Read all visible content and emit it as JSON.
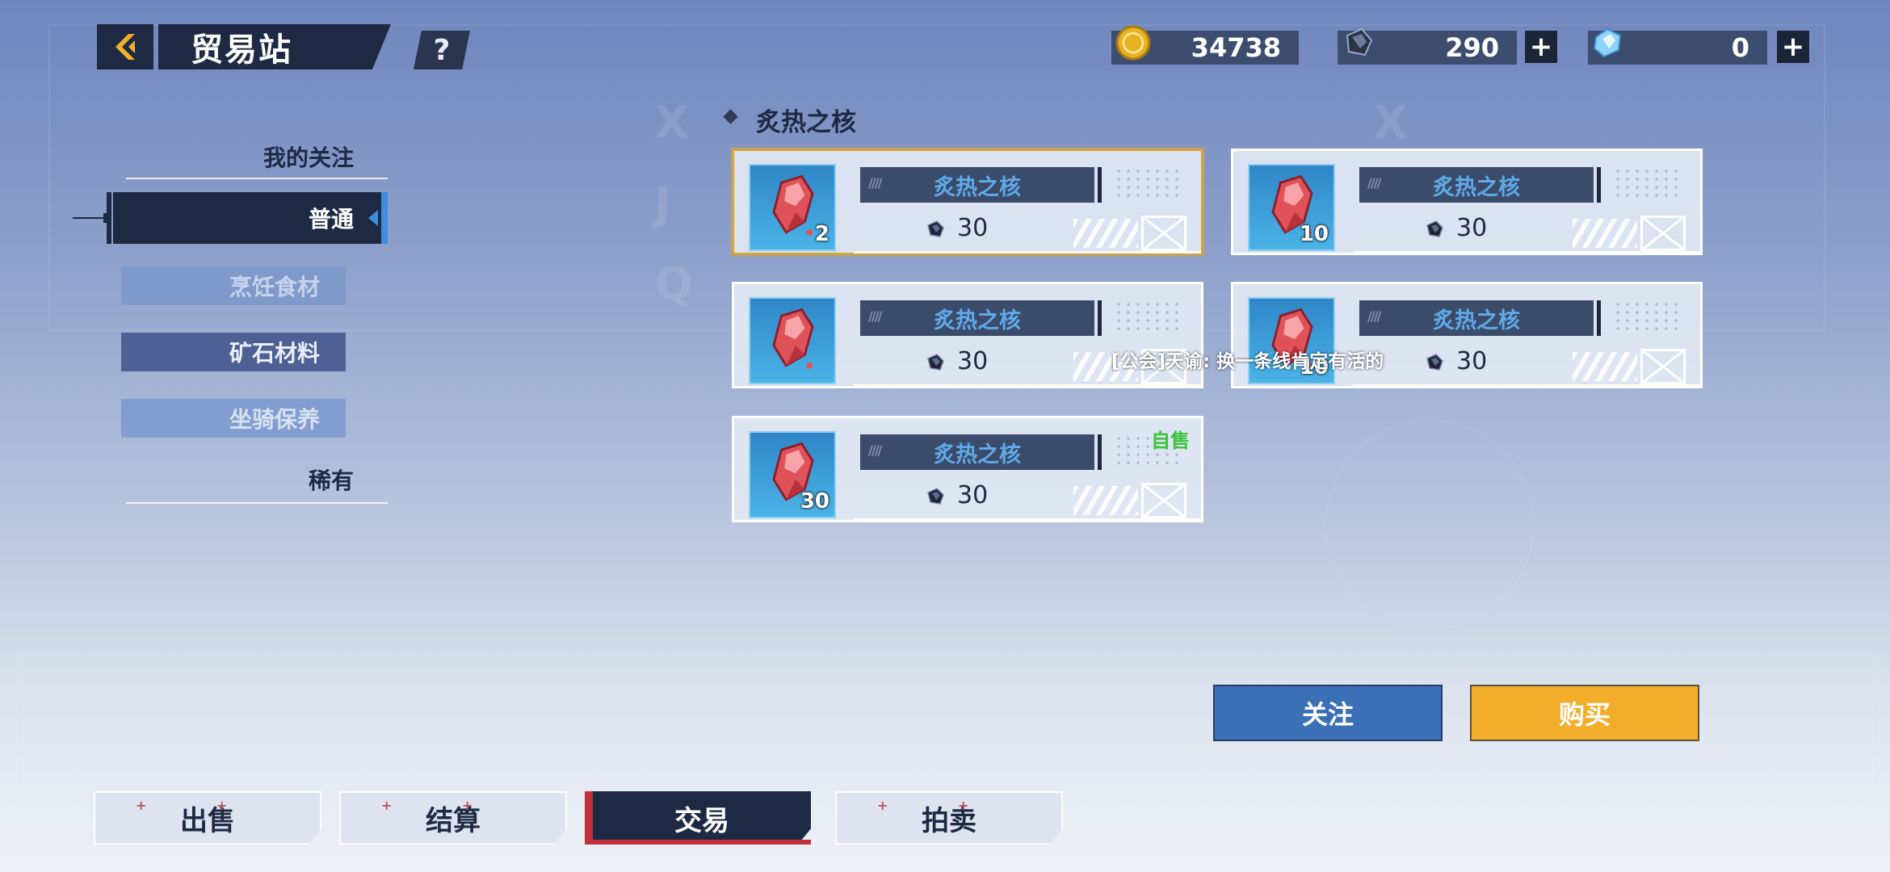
{
  "header": {
    "title": "贸易站",
    "help_label": "?"
  },
  "currencies": [
    {
      "icon": "gold-coin-icon",
      "value": "34738",
      "has_plus": false
    },
    {
      "icon": "dark-crystal-icon",
      "value": "290",
      "has_plus": true
    },
    {
      "icon": "blue-crystal-icon",
      "value": "0",
      "has_plus": true
    }
  ],
  "plus_label": "+",
  "sidebar": {
    "favorites_heading": "我的关注",
    "common_heading": "普通",
    "items": [
      {
        "label": "烹饪食材"
      },
      {
        "label": "矿石材料"
      },
      {
        "label": "坐骑保养"
      }
    ],
    "rare_heading": "稀有"
  },
  "category": {
    "title": "炙热之核"
  },
  "listings": [
    {
      "name": "炙热之核",
      "qty": "2",
      "price": "30",
      "selected": true,
      "self_sell": false
    },
    {
      "name": "炙热之核",
      "qty": "10",
      "price": "30",
      "selected": false,
      "self_sell": false
    },
    {
      "name": "炙热之核",
      "qty": "",
      "price": "30",
      "selected": false,
      "self_sell": false
    },
    {
      "name": "炙热之核",
      "qty": "10",
      "price": "30",
      "selected": false,
      "self_sell": false
    },
    {
      "name": "炙热之核",
      "qty": "30",
      "price": "30",
      "selected": false,
      "self_sell": true
    }
  ],
  "self_sell_label": "自售",
  "chat_message": "[公会]天谕: 换一条线肯定有活的",
  "actions": {
    "follow_label": "关注",
    "buy_label": "购买"
  },
  "tabs": [
    {
      "label": "出售",
      "active": false
    },
    {
      "label": "结算",
      "active": false
    },
    {
      "label": "交易",
      "active": true
    },
    {
      "label": "拍卖",
      "active": false
    }
  ],
  "colors": {
    "accent_blue": "#3d8ee0",
    "buy_orange": "#f2ae2a",
    "follow_blue": "#3b6fb6",
    "dark_navy": "#1e2a44",
    "selected_border": "#d6a53a",
    "self_sell_green": "#3ac43a"
  }
}
